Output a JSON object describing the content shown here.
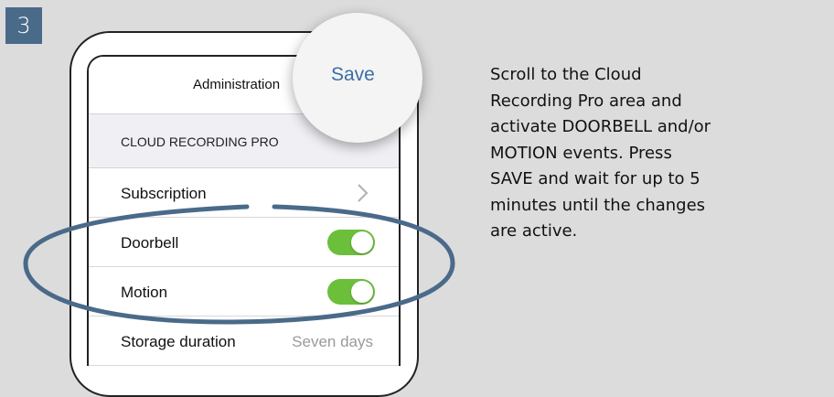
{
  "step": {
    "number": "3"
  },
  "app": {
    "nav_title": "Administration",
    "save_label": "Save",
    "section_header": "CLOUD RECORDING PRO",
    "rows": [
      {
        "label": "Subscription",
        "type": "chevron"
      },
      {
        "label": "Doorbell",
        "type": "toggle",
        "on": true
      },
      {
        "label": "Motion",
        "type": "toggle",
        "on": true
      },
      {
        "label": "Storage duration",
        "type": "value",
        "value": "Seven days"
      }
    ],
    "toggle_color": "#6bbf3a",
    "link_color": "#3a6fa5",
    "highlight_color": "#4a6a8a"
  },
  "instructions": {
    "lines": [
      "Scroll to the Cloud",
      "Recording Pro area and",
      "activate DOORBELL and/or",
      "MOTION events. Press",
      "SAVE and wait for up to 5",
      "minutes until the changes",
      "are active."
    ]
  }
}
